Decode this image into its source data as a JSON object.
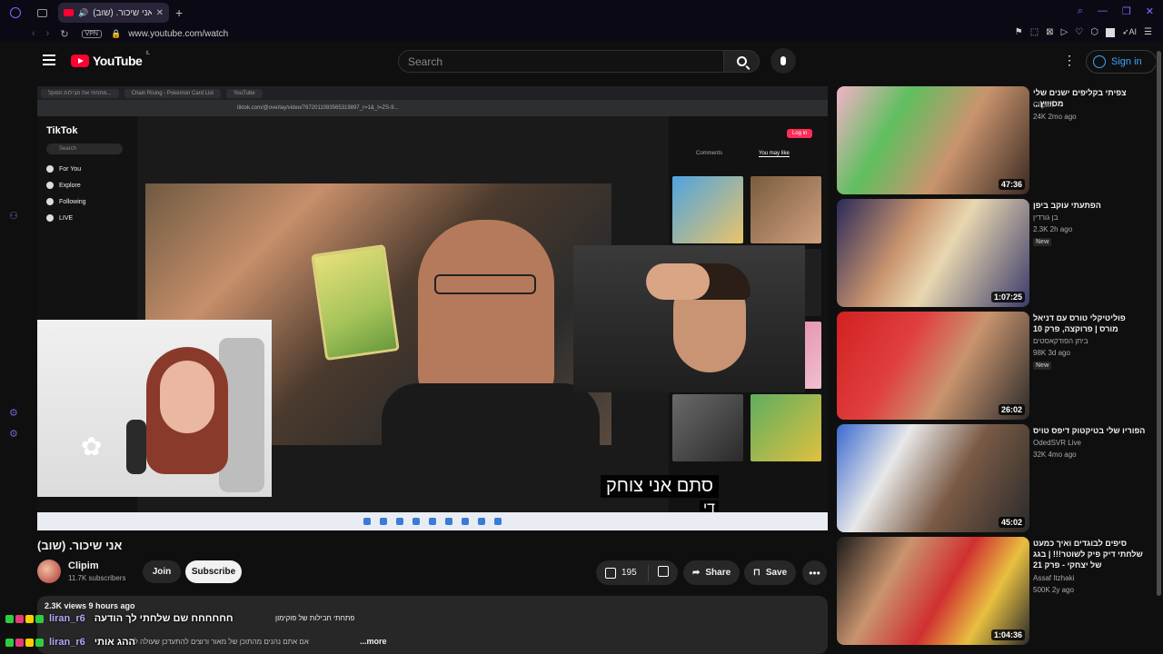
{
  "browser": {
    "tab_title": "אני שיכור. (שוב) - YouTube",
    "url": "www.youtube.com/watch",
    "vpn_label": "VPN",
    "ai_label": "AI"
  },
  "youtube": {
    "logo_text": "YouTube",
    "country_code": "IL",
    "search_placeholder": "Search",
    "signin_label": "Sign in"
  },
  "player": {
    "inner_tabs": [
      "מתחתי את חבילות הפוקל...",
      "Chain Rising - Pokemon Card List",
      "YouTube"
    ],
    "inner_url": "tiktok.com/@overlay/video/7672011093565319897_r=1&_t=ZS-9...",
    "tiktok": {
      "logo": "TikTok",
      "search": "Search",
      "nav": [
        "For You",
        "Explore",
        "Following",
        "LIVE"
      ],
      "login": "Log in",
      "tabs": [
        "Comments",
        "You may like"
      ]
    },
    "caption_line1": "סתם אני צוחק",
    "caption_line2": "די"
  },
  "video": {
    "title": "אני שיכור. (שוב)",
    "channel": "Clipim",
    "subscribers": "11.7K subscribers",
    "join_label": "Join",
    "subscribe_label": "Subscribe",
    "likes": "195",
    "share_label": "Share",
    "save_label": "Save",
    "more_label": "•••",
    "views_meta": "2.3K views  9 hours ago",
    "desc_line1": "פתחתי חבילות של פוקימון",
    "desc_line2": "אם אתם נהנים מהתוכן של מאור ורוצים להתעדכן שעולה ל...",
    "desc_more": "...more"
  },
  "chat_overlay": [
    {
      "nick": "liran_r6",
      "msg": "חחחחחח שם שלחתי לך הודעה"
    },
    {
      "nick": "liran_r6",
      "msg": "ההג אותי"
    }
  ],
  "rail": [
    {
      "title": "צפיתי בקליפים ישנים שלי מסוויץ...",
      "channel": "Clipim",
      "stats": "24K  2mo ago",
      "new": "",
      "duration": "47:36"
    },
    {
      "title": "הפתעתי עוקב ביפן",
      "channel": "בן גורדין",
      "stats": "2.3K  2h ago",
      "new": "New",
      "duration": "1:07:25"
    },
    {
      "title": "פוליטיקלי טורס עם דניאל מורס | פרוקצה, פרק 10",
      "channel": "ביתן הפודקאסטים",
      "stats": "98K  3d ago",
      "new": "New",
      "duration": "26:02"
    },
    {
      "title": "הפוריו שלי בטיקטוק דיפס טויס",
      "channel": "OdedSVR Live",
      "stats": "32K  4mo ago",
      "new": "",
      "duration": "45:02"
    },
    {
      "title": "סיפים לבוגדים ואיך כמעט שלחתי דיק פיק לשוטר!!! | בגג של יצחקי - פרק 21",
      "channel": "Assaf Itzhaki",
      "stats": "500K  2y ago",
      "new": "",
      "duration": "1:04:36"
    }
  ],
  "colors": {
    "brand_red": "#ff0033",
    "link_blue": "#3ea6ff",
    "chip_bg": "#272727",
    "page_bg": "#0f0f0f"
  }
}
